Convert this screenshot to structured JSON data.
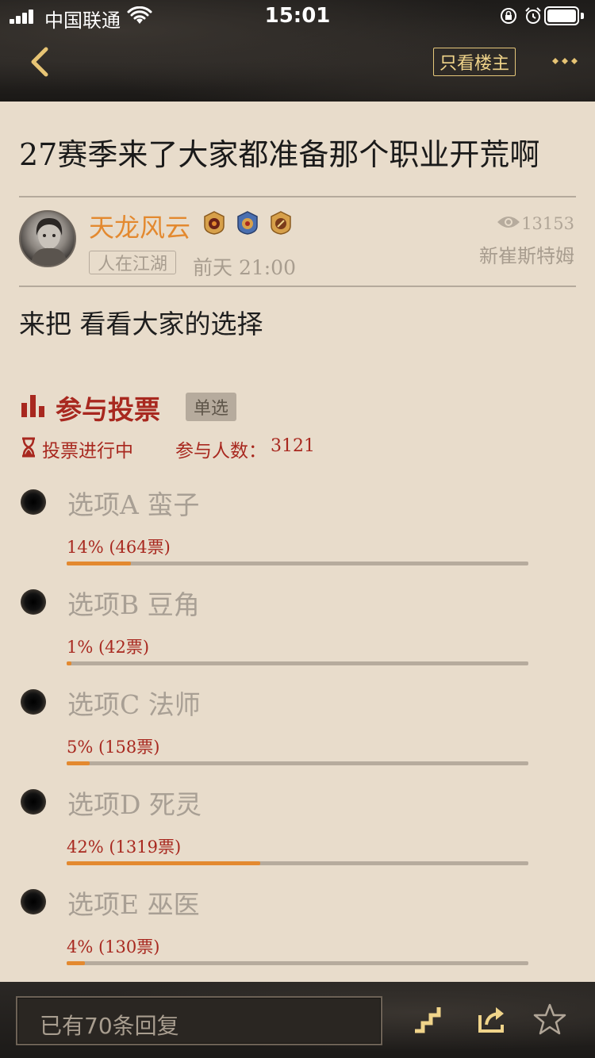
{
  "status_bar": {
    "carrier": "中国联通",
    "time": "15:01"
  },
  "nav": {
    "only_owner_label": "只看楼主"
  },
  "post": {
    "title": "27赛季来了大家都准备那个职业开荒啊",
    "author": "天龙风云",
    "user_tag": "人在江湖",
    "time": "前天 21:00",
    "views": "13153",
    "location": "新崔斯特姆",
    "body": "来把 看看大家的选择"
  },
  "vote": {
    "title": "参与投票",
    "type": "单选",
    "status": "投票进行中",
    "count_label": "参与人数：",
    "count": "3121",
    "options": [
      {
        "label": "选项A  蛮子",
        "result": "14% (464票)",
        "percent": 14
      },
      {
        "label": "选项B  豆角",
        "result": "1% (42票)",
        "percent": 1
      },
      {
        "label": "选项C  法师",
        "result": "5% (158票)",
        "percent": 5
      },
      {
        "label": "选项D  死灵",
        "result": "42% (1319票)",
        "percent": 42
      },
      {
        "label": "选项E  巫医",
        "result": "4% (130票)",
        "percent": 4
      }
    ]
  },
  "bottom": {
    "reply_placeholder": "已有70条回复"
  },
  "colors": {
    "accent": "#e3892f",
    "vote_red": "#a8281f",
    "background": "#e8dccb",
    "gold": "#f0d48a"
  },
  "icons": [
    "back-icon",
    "more-icon",
    "eye-icon",
    "vote-chart-icon",
    "hourglass-icon",
    "stairs-icon",
    "share-icon",
    "star-icon"
  ]
}
